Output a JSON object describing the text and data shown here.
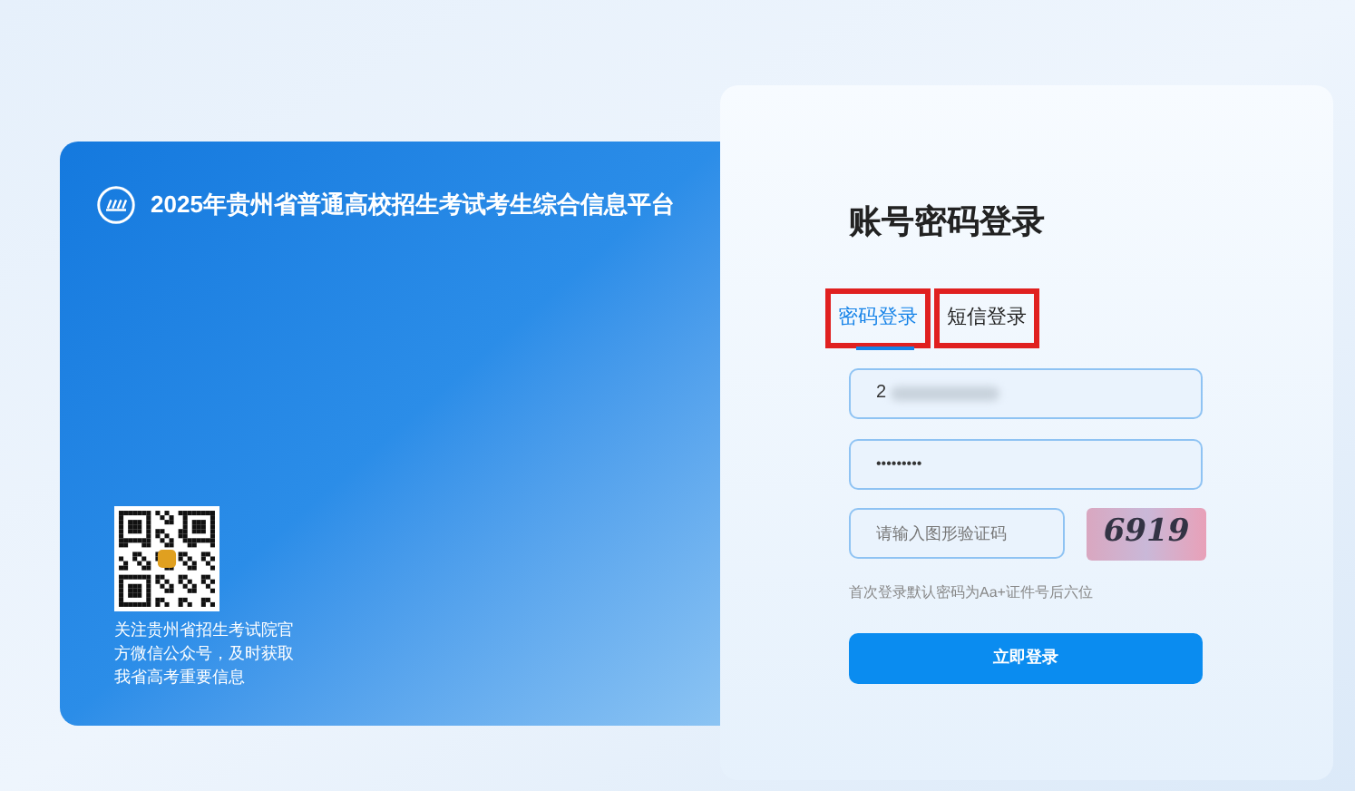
{
  "banner": {
    "title": "2025年贵州省普通高校招生考试考生综合信息平台",
    "qr_caption": "关注贵州省招生考试院官方微信公众号，及时获取我省高考重要信息"
  },
  "login": {
    "heading": "账号密码登录",
    "tabs": [
      {
        "label": "密码登录",
        "selected": true,
        "highlighted": true
      },
      {
        "label": "短信登录",
        "selected": false,
        "highlighted": true
      }
    ],
    "username": {
      "value": "2",
      "blurred": true
    },
    "password": {
      "value": "•••••••••"
    },
    "captcha": {
      "placeholder": "请输入图形验证码",
      "image_text": "6919"
    },
    "note": "首次登录默认密码为Aa+证件号后六位",
    "submit": "立即登录"
  }
}
